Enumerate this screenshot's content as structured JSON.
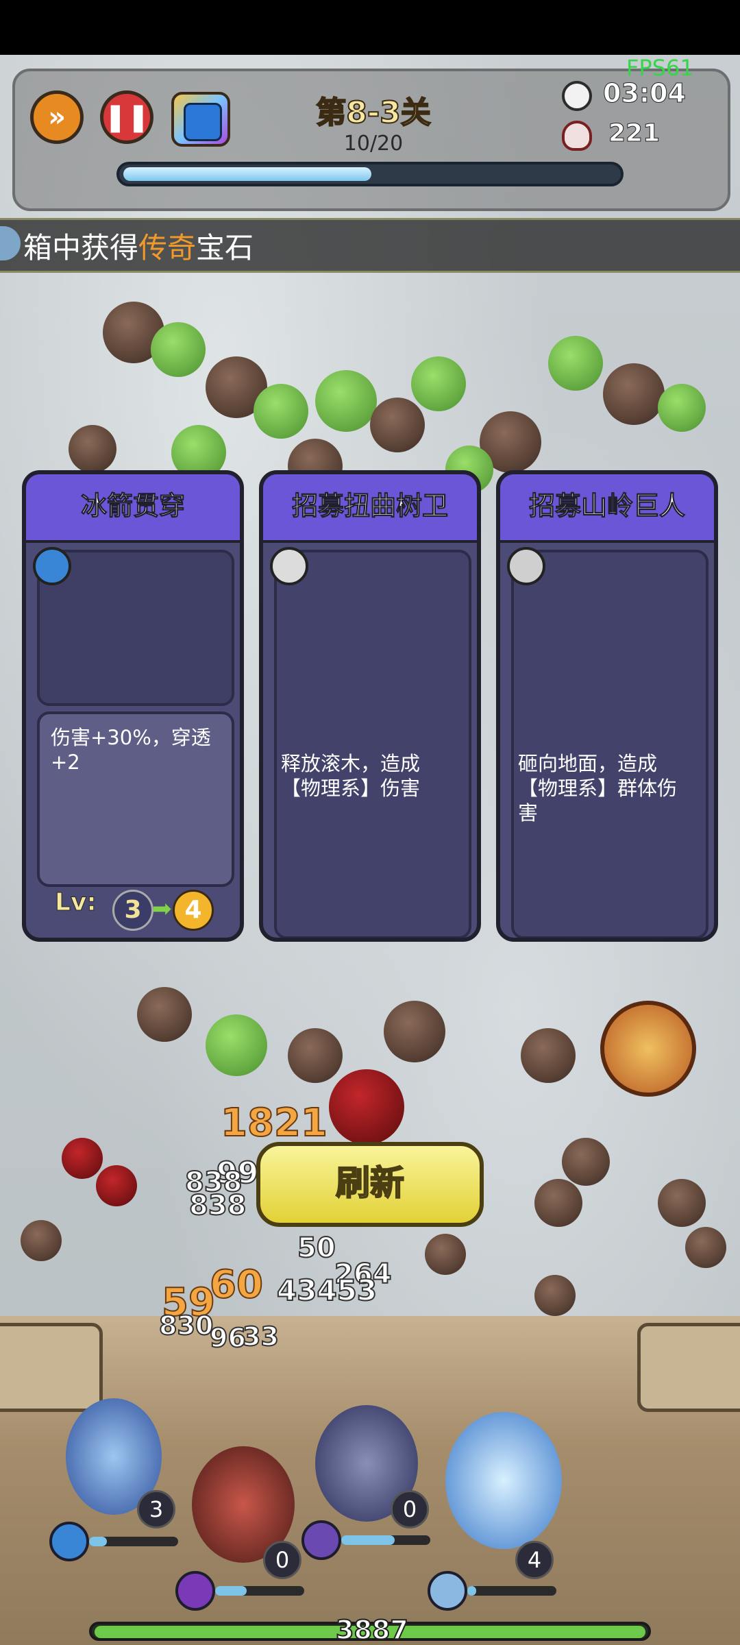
{
  "status": {
    "fps": "FPS61"
  },
  "hud": {
    "level_title": "第8-3关",
    "wave": "10/20",
    "wave_progress": 0.5,
    "timer": "03:04",
    "kills": "221",
    "icons": {
      "speed": "fast-forward-icon",
      "pause": "pause-icon",
      "deck": "card-deck-icon",
      "clock": "clock-icon",
      "skull": "skull-icon"
    }
  },
  "ticker": {
    "prefix": "箱中获得",
    "highlight": "传奇",
    "suffix": "宝石"
  },
  "cards": [
    {
      "title": "冰箭贯穿",
      "desc": "伤害+30%，穿透+2",
      "lv_label": "Lv:",
      "lv_from": "3",
      "lv_to": "4",
      "badge": "ice-arrow-icon"
    },
    {
      "title": "招募扭曲树卫",
      "desc": "释放滚木，造成【物理系】伤害",
      "badge": "stone-icon"
    },
    {
      "title": "招募山岭巨人",
      "desc": "砸向地面，造成【物理系】群体伤害",
      "badge": "rock-spike-icon"
    }
  ],
  "refresh_label": "刷新",
  "damage_numbers": [
    "1821",
    "99",
    "838",
    "838",
    "50",
    "264",
    "43453",
    "59",
    "60",
    "830",
    "96",
    "33"
  ],
  "heroes": [
    {
      "name": "ice-mage",
      "count": "3"
    },
    {
      "name": "hooded-warrior",
      "count": "0"
    },
    {
      "name": "dark-archer",
      "count": "0"
    },
    {
      "name": "frost-knight",
      "count": "4"
    }
  ],
  "base_hp": "3887",
  "colors": {
    "accent": "#6b56d8",
    "highlight": "#f19a2c",
    "fps": "#36d64a"
  }
}
